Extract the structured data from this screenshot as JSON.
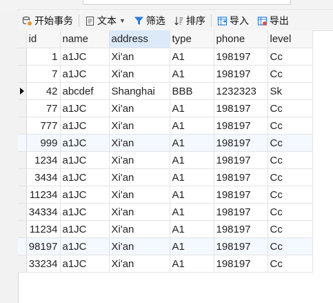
{
  "toolbar": {
    "begin_transaction": "开始事务",
    "text": "文本",
    "filter": "筛选",
    "sort": "排序",
    "import": "导入",
    "export": "导出"
  },
  "columns": [
    "id",
    "name",
    "address",
    "type",
    "phone",
    "level"
  ],
  "rows": [
    {
      "id": "1",
      "name": "a1JC",
      "address": "Xi'an",
      "type": "A1",
      "phone": "198197",
      "level": "Cc"
    },
    {
      "id": "7",
      "name": "a1JC",
      "address": "Xi'an",
      "type": "A1",
      "phone": "198197",
      "level": "Cc"
    },
    {
      "id": "42",
      "name": "abcdef",
      "address": "Shanghai",
      "type": "BBB",
      "phone": "1232323",
      "level": "Sk"
    },
    {
      "id": "77",
      "name": "a1JC",
      "address": "Xi'an",
      "type": "A1",
      "phone": "198197",
      "level": "Cc"
    },
    {
      "id": "777",
      "name": "a1JC",
      "address": "Xi'an",
      "type": "A1",
      "phone": "198197",
      "level": "Cc"
    },
    {
      "id": "999",
      "name": "a1JC",
      "address": "Xi'an",
      "type": "A1",
      "phone": "198197",
      "level": "Cc"
    },
    {
      "id": "1234",
      "name": "a1JC",
      "address": "Xi'an",
      "type": "A1",
      "phone": "198197",
      "level": "Cc"
    },
    {
      "id": "3434",
      "name": "a1JC",
      "address": "Xi'an",
      "type": "A1",
      "phone": "198197",
      "level": "Cc"
    },
    {
      "id": "11234",
      "name": "a1JC",
      "address": "Xi'an",
      "type": "A1",
      "phone": "198197",
      "level": "Cc"
    },
    {
      "id": "34334",
      "name": "a1JC",
      "address": "Xi'an",
      "type": "A1",
      "phone": "198197",
      "level": "Cc"
    },
    {
      "id": "11234",
      "name": "a1JC",
      "address": "Xi'an",
      "type": "A1",
      "phone": "198197",
      "level": "Cc"
    },
    {
      "id": "98197",
      "name": "a1JC",
      "address": "Xi'an",
      "type": "A1",
      "phone": "198197",
      "level": "Cc"
    },
    {
      "id": "33234",
      "name": "a1JC",
      "address": "Xi'an",
      "type": "A1",
      "phone": "198197",
      "level": "Cc"
    }
  ],
  "active_column": "address",
  "current_row_index": 2,
  "highlighted_rows": [
    5,
    11
  ],
  "colors": {
    "active_header": "#dbe9f9",
    "alt_row": "#f4f8ff",
    "filter_icon": "#2b7cd3",
    "import_icon": "#2b7cd3",
    "export_icon": "#d9534f"
  }
}
